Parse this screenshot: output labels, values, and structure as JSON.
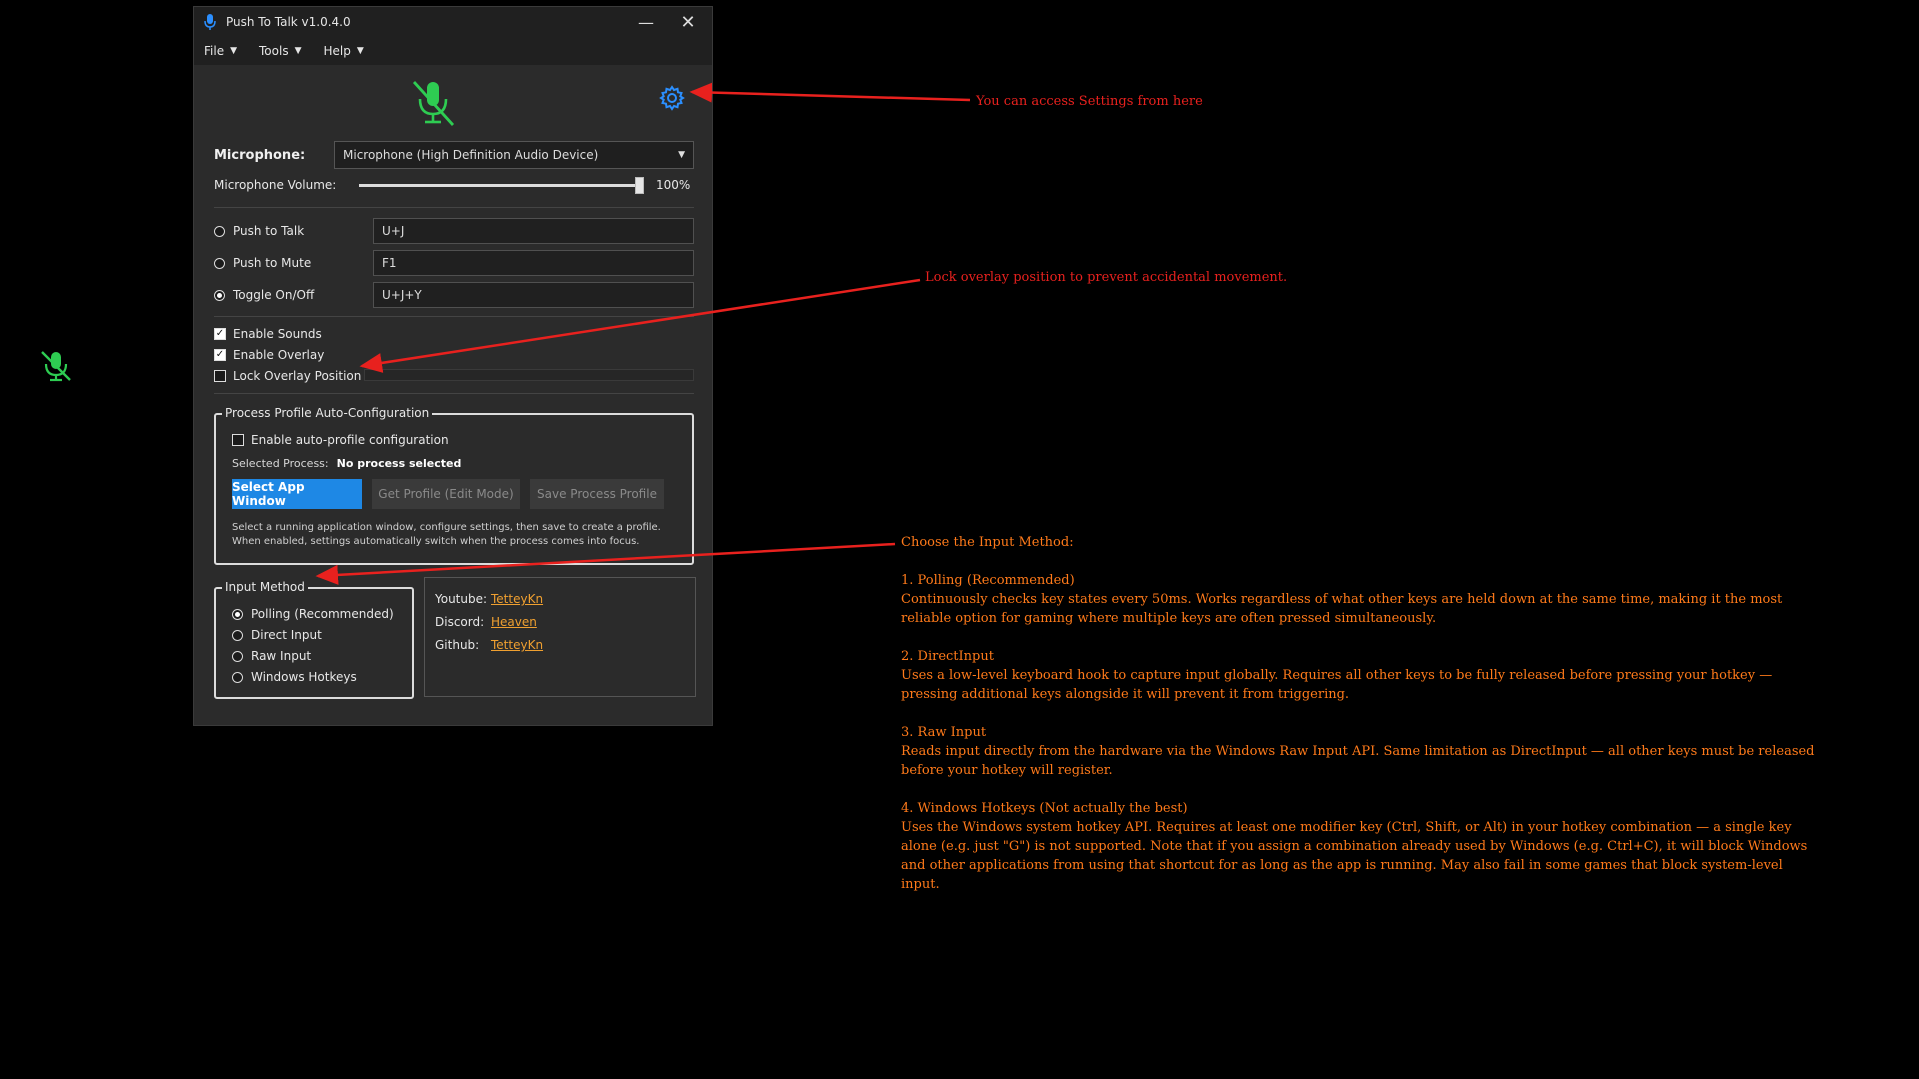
{
  "window": {
    "title": "Push To Talk v1.0.4.0",
    "minimize_glyph": "—",
    "close_glyph": "✕"
  },
  "menu": [
    {
      "label": "File"
    },
    {
      "label": "Tools"
    },
    {
      "label": "Help"
    }
  ],
  "icons": {
    "title": "microphone-icon",
    "main": "microphone-muted-icon",
    "settings": "gear-icon",
    "overlay": "microphone-muted-icon",
    "accent_green": "#2ecc52",
    "accent_blue": "#2b8fff"
  },
  "microphone": {
    "label": "Microphone:",
    "selected": "Microphone (High Definition Audio Device)"
  },
  "volume": {
    "label": "Microphone Volume:",
    "value": 100,
    "value_text": "100%"
  },
  "hotkeys": [
    {
      "label": "Push to Talk",
      "value": "U+J",
      "selected": false
    },
    {
      "label": "Push to Mute",
      "value": "F1",
      "selected": false
    },
    {
      "label": "Toggle On/Off",
      "value": "U+J+Y",
      "selected": true
    }
  ],
  "options": [
    {
      "label": "Enable Sounds",
      "checked": true
    },
    {
      "label": "Enable Overlay",
      "checked": true
    },
    {
      "label": "Lock Overlay Position",
      "checked": false
    }
  ],
  "profile": {
    "title": "Process Profile Auto-Configuration",
    "enable_label": "Enable auto-profile configuration",
    "enabled": false,
    "selected_label": "Selected Process:",
    "selected_value": "No process selected",
    "buttons": {
      "select": "Select App Window",
      "get": "Get Profile (Edit Mode)",
      "save": "Save Process Profile"
    },
    "hint": "Select a running application window, configure settings, then save to create a profile. When enabled, settings automatically switch when the process comes into focus."
  },
  "input_method": {
    "title": "Input Method",
    "options": [
      {
        "label": "Polling (Recommended)",
        "selected": true
      },
      {
        "label": "Direct Input",
        "selected": false
      },
      {
        "label": "Raw Input",
        "selected": false
      },
      {
        "label": "Windows Hotkeys",
        "selected": false
      }
    ]
  },
  "links": [
    {
      "key": "Youtube:",
      "value": "TetteyKn"
    },
    {
      "key": "Discord:",
      "value": "Heaven"
    },
    {
      "key": "Github:",
      "value": "TetteyKn"
    }
  ],
  "annotations": {
    "settings": "You can access Settings from here",
    "lock": "Lock overlay position to prevent accidental movement.",
    "input_method": [
      "Choose the Input Method:",
      "",
      "1. Polling (Recommended)",
      "Continuously checks key states every 50ms. Works regardless of what other keys are held down at the same time, making it the most reliable option for gaming where multiple keys are often pressed simultaneously.",
      "",
      "2. DirectInput",
      "Uses a low-level keyboard hook to capture input globally. Requires all other keys to be fully released before pressing your hotkey — pressing additional keys alongside it will prevent it from triggering.",
      "",
      "3. Raw Input",
      "Reads input directly from the hardware via the Windows Raw Input API. Same limitation as DirectInput — all other keys must be released before your hotkey will register.",
      "",
      "4. Windows Hotkeys (Not actually the best)",
      "Uses the Windows system hotkey API. Requires at least one modifier key (Ctrl, Shift, or Alt) in your hotkey combination — a single key alone (e.g. just \"G\") is not supported. Note that if you assign a combination already used by Windows (e.g. Ctrl+C), it will block Windows and other applications from using that shortcut for as long as the app is running. May also fail in some games that block system-level input."
    ],
    "colors": {
      "red": "#e8211e",
      "orange": "#ff7a1a"
    }
  }
}
